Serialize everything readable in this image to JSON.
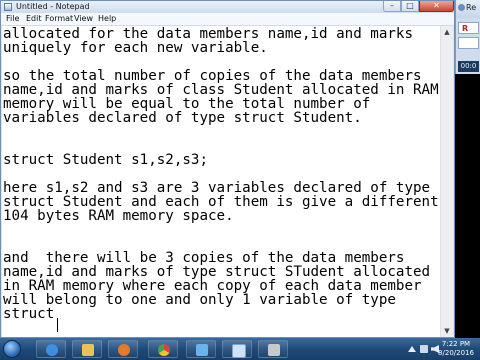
{
  "window": {
    "title": "Untitled - Notepad",
    "min_glyph": "–",
    "max_glyph": "□",
    "close_glyph": "✕"
  },
  "menu": [
    "File",
    "Edit",
    "Format",
    "View",
    "Help"
  ],
  "editor": {
    "lines": [
      "allocated for the data members name,id and marks",
      "uniquely for each new variable.",
      "",
      "so the total number of copies of the data members",
      "name,id and marks of class Student allocated in RAM",
      "memory will be equal to the total number of",
      "variables declared of type struct Student.",
      "",
      "",
      "struct Student s1,s2,s3;",
      "",
      "here s1,s2 and s3 are 3 variables declared of type",
      "struct Student and each of them is give a different",
      "104 bytes RAM memory space.",
      "",
      "",
      "and  there will be 3 copies of the data members",
      "name,id and marks of type struct STudent allocated",
      "in RAM memory where each copy of each data member",
      "will belong to one and only 1 variable of type",
      "struct"
    ]
  },
  "side_panel": {
    "title": "Re",
    "button1_label": "R",
    "timer": "00:0"
  },
  "taskbar": {
    "apps": [
      {
        "name": "internet-explorer",
        "color": "#3f8fe0"
      },
      {
        "name": "file-explorer",
        "color": "#e8c35a"
      },
      {
        "name": "media-player",
        "color": "#e57a2b"
      },
      {
        "name": "chrome",
        "color": "#d8463b"
      },
      {
        "name": "paint",
        "color": "#6ab3e8"
      },
      {
        "name": "notepad",
        "color": "#cfe2f7"
      },
      {
        "name": "generic-app",
        "color": "#c9c9c9"
      }
    ],
    "time": "7:22 PM",
    "date": "8/20/2016"
  },
  "colors": {
    "title_bar": "#dbe6f4",
    "taskbar": "#1f4a78",
    "close_button": "#c9462d"
  }
}
